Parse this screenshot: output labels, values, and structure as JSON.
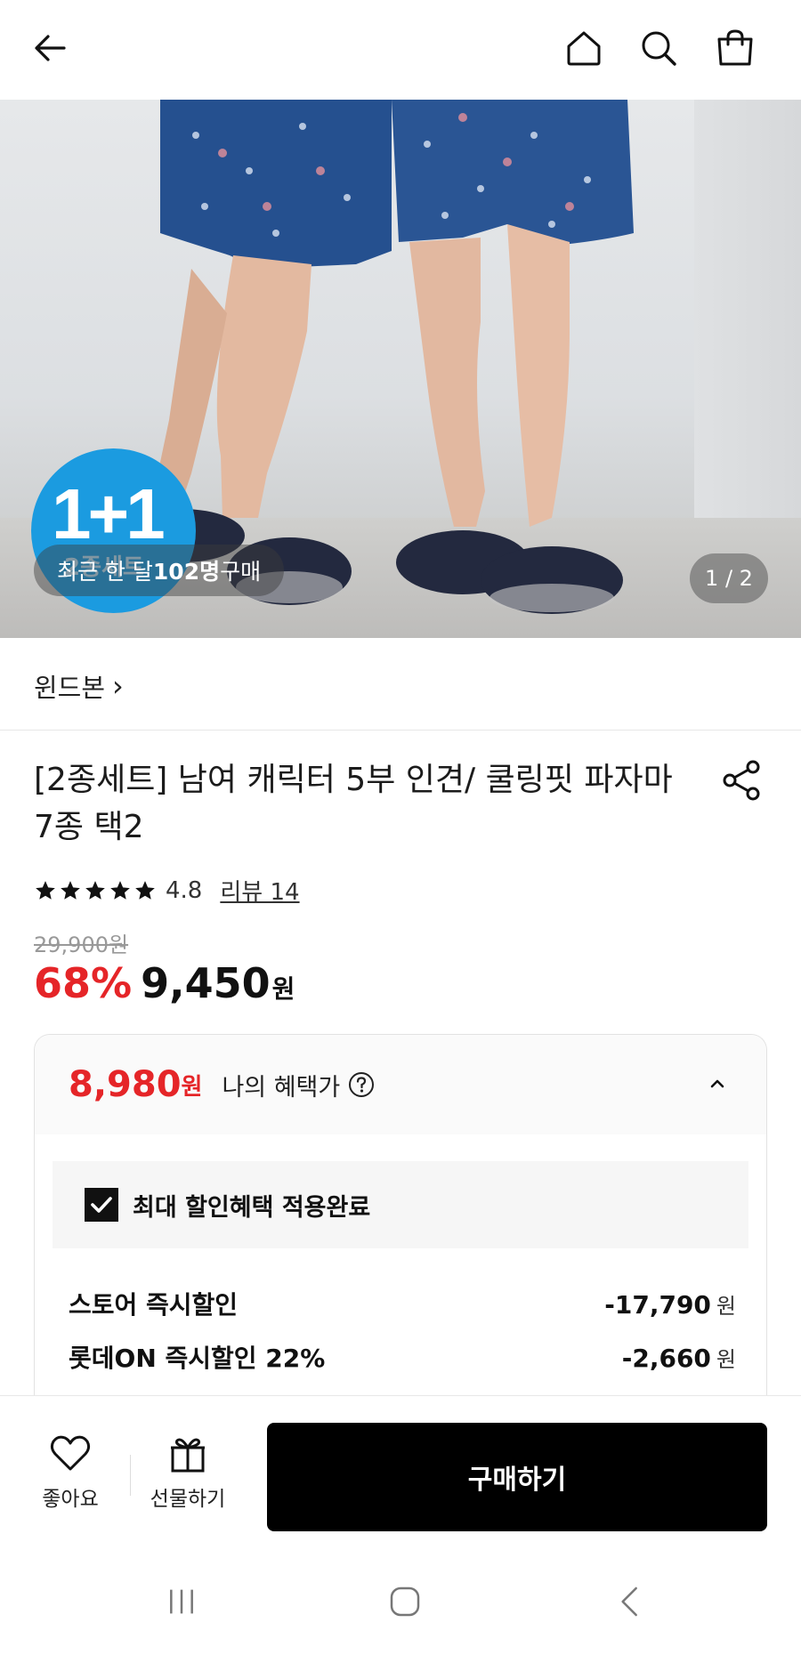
{
  "header": {
    "icons": [
      "back-arrow-icon",
      "home-icon",
      "search-icon",
      "shopping-bag-icon"
    ]
  },
  "hero": {
    "badge": "1+1",
    "badge_sub": "2종세트",
    "buyers_prefix": "최근 한 달 ",
    "buyers_count": "102명",
    "buyers_suffix": " 구매",
    "page_indicator": "1 / 2"
  },
  "brand": {
    "name": "윈드본",
    "chevron": "›"
  },
  "product": {
    "title": "[2종세트] 남여 캐릭터 5부 인견/ 쿨링핏 파자마 7종 택2",
    "rating": "4.8",
    "star_count": 5,
    "review_link": "리뷰 14",
    "original_price": "29,900원",
    "discount_rate": "68%",
    "price": "9,450",
    "currency": "원"
  },
  "benefit": {
    "price": "8,980",
    "currency": "원",
    "label": "나의 혜택가",
    "max_applied": "최대 할인혜택 적용완료",
    "discounts": [
      {
        "name": "스토어 즉시할인",
        "amount": "-17,790",
        "unit": "원"
      },
      {
        "name": "롯데ON 즉시할인 22%",
        "amount": "-2,660",
        "unit": "원"
      }
    ]
  },
  "bottom_bar": {
    "like_label": "좋아요",
    "gift_label": "선물하기",
    "buy_label": "구매하기"
  },
  "colors": {
    "accent_red": "#e52528",
    "badge_blue": "#1b9be0",
    "buy_button": "#000000"
  }
}
